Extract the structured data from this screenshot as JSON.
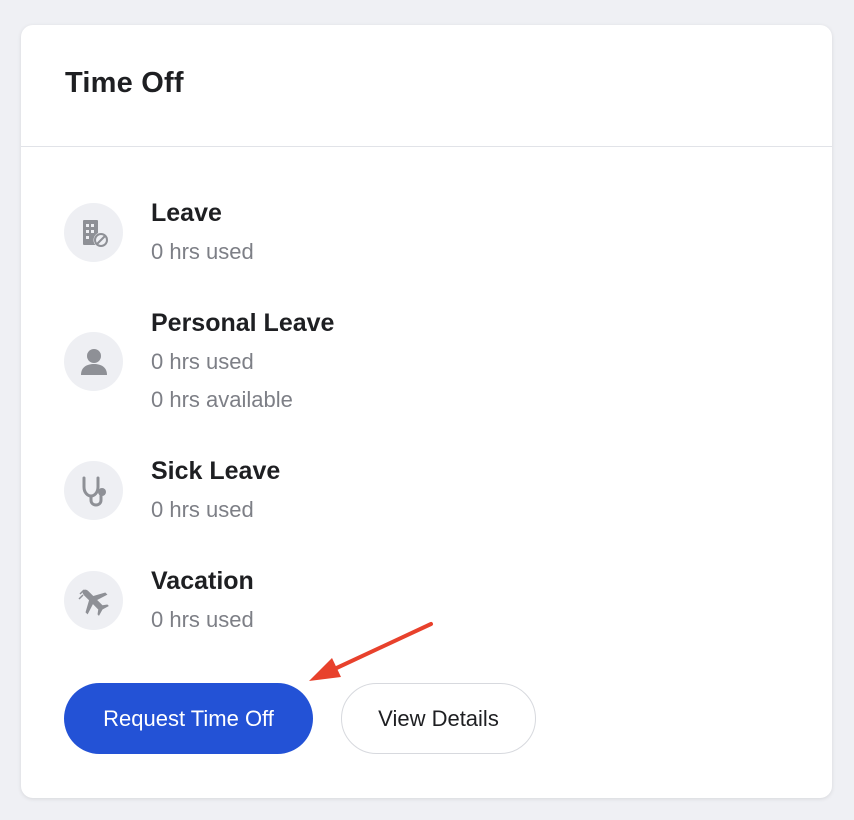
{
  "card": {
    "title": "Time Off"
  },
  "leave_types": [
    {
      "name": "Leave",
      "lines": [
        "0 hrs used"
      ],
      "icon": "building-blocked-icon"
    },
    {
      "name": "Personal Leave",
      "lines": [
        "0 hrs used",
        "0 hrs available"
      ],
      "icon": "person-icon"
    },
    {
      "name": "Sick Leave",
      "lines": [
        "0 hrs used"
      ],
      "icon": "stethoscope-icon"
    },
    {
      "name": "Vacation",
      "lines": [
        "0 hrs used"
      ],
      "icon": "airplane-icon"
    }
  ],
  "actions": {
    "request_label": "Request Time Off",
    "details_label": "View Details"
  },
  "colors": {
    "primary": "#2352d6",
    "annotation_arrow": "#e8412c",
    "icon": "#8e9096"
  }
}
